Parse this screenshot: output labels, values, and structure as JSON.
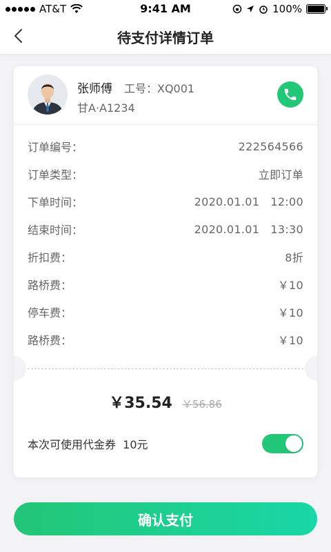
{
  "status_bar": {
    "carrier": "AT&T",
    "time": "9:41 AM",
    "battery": "100%",
    "battery_level": 1.0
  },
  "nav": {
    "back_icon": "chevron-left-icon",
    "title": "待支付详情订单"
  },
  "driver": {
    "name": "张师傅",
    "id_label": "工号：XQ001",
    "plate": "甘A·A1234",
    "call_icon": "phone-icon"
  },
  "order": {
    "rows": [
      {
        "label": "订单编号：",
        "value": "222564566"
      },
      {
        "label": "订单类型：",
        "value": "立即订单"
      },
      {
        "label": "下单时间：",
        "value": "2020.01.01   12:00"
      },
      {
        "label": "结束时间：",
        "value": "2020.01.01   13:30"
      },
      {
        "label": "折扣费：",
        "value": "8折"
      },
      {
        "label": "路桥费：",
        "value": "￥10"
      },
      {
        "label": "停车费：",
        "value": "￥10"
      },
      {
        "label": "路桥费：",
        "value": "￥10"
      }
    ]
  },
  "price": {
    "current": "￥35.54",
    "original": "￥56.86"
  },
  "coupon": {
    "label": "本次可使用代金券  10元",
    "enabled": true
  },
  "pay_button": {
    "label": "确认支付"
  },
  "colors": {
    "accent": "#22c777",
    "accent_end": "#19d7a7",
    "background": "#f3f3f5"
  }
}
